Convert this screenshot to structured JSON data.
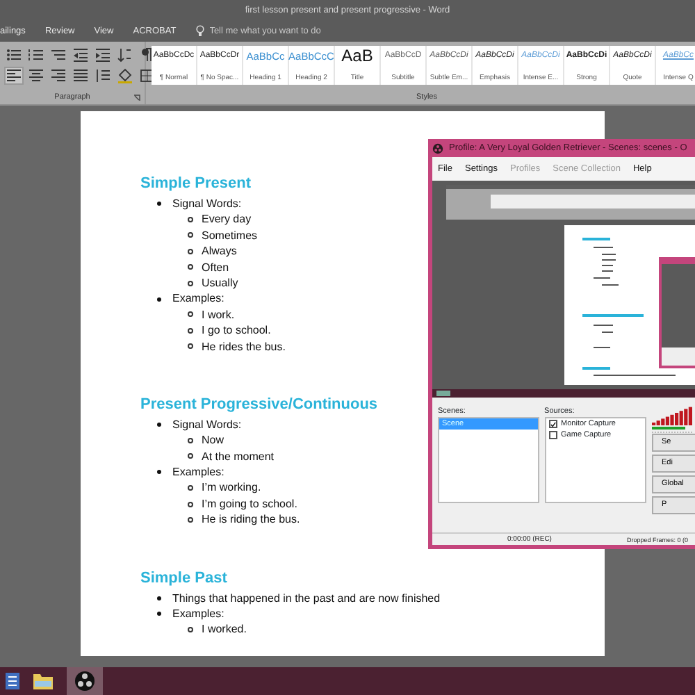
{
  "window": {
    "title": "first lesson present and present progressive - Word"
  },
  "ribbon_tabs": [
    {
      "label": "ailings"
    },
    {
      "label": "Review"
    },
    {
      "label": "View"
    },
    {
      "label": "ACROBAT"
    }
  ],
  "tell_me": {
    "placeholder": "Tell me what you want to do"
  },
  "paragraph_group": {
    "label": "Paragraph",
    "tools": [
      {
        "kind": "bullets"
      },
      {
        "kind": "numbering"
      },
      {
        "kind": "multilevel"
      },
      {
        "kind": "outdent"
      },
      {
        "kind": "indent"
      },
      {
        "kind": "sort"
      },
      {
        "kind": "pilcrow"
      },
      {
        "kind": "align-left",
        "selected": true
      },
      {
        "kind": "align-center",
        "selected": false
      },
      {
        "kind": "align-right",
        "selected": false
      },
      {
        "kind": "justify",
        "selected": false
      },
      {
        "kind": "spacing"
      },
      {
        "kind": "shading"
      },
      {
        "kind": "borders"
      }
    ]
  },
  "styles_group": {
    "label": "Styles",
    "styles": [
      {
        "preview": "AaBbCcDc",
        "name": "¶ Normal",
        "kind": "normal"
      },
      {
        "preview": "AaBbCcDr",
        "name": "¶ No Spac...",
        "kind": "normal"
      },
      {
        "preview": "AaBbCc",
        "name": "Heading 1",
        "kind": "heading"
      },
      {
        "preview": "AaBbCcC",
        "name": "Heading 2",
        "kind": "heading"
      },
      {
        "preview": "AaB",
        "name": "Title",
        "kind": "title"
      },
      {
        "preview": "AaBbCcD",
        "name": "Subtitle",
        "kind": "subtle"
      },
      {
        "preview": "AaBbCcDi",
        "name": "Subtle Em...",
        "kind": "subtle-italic"
      },
      {
        "preview": "AaBbCcDi",
        "name": "Emphasis",
        "kind": "italic"
      },
      {
        "preview": "AaBbCcDi",
        "name": "Intense E...",
        "kind": "accent-italic"
      },
      {
        "preview": "AaBbCcDi",
        "name": "Strong",
        "kind": "bold"
      },
      {
        "preview": "AaBbCcDi",
        "name": "Quote",
        "kind": "italic"
      },
      {
        "preview": "AaBbCc",
        "name": "Intense Q",
        "kind": "accent-underline"
      }
    ]
  },
  "document": {
    "sections": [
      {
        "heading": "Simple Present",
        "items": [
          {
            "text": "Signal Words:",
            "children": [
              {
                "text": "Every day"
              },
              {
                "text": "Sometimes"
              },
              {
                "text": "Always"
              },
              {
                "text": "Often"
              },
              {
                "text": "Usually"
              }
            ]
          },
          {
            "text": "Examples:",
            "children": [
              {
                "text": "I work."
              },
              {
                "text": "I go to school."
              },
              {
                "text": "He rides the bus."
              }
            ]
          }
        ]
      },
      {
        "heading": "Present Progressive/Continuous",
        "items": [
          {
            "text": "Signal Words:",
            "children": [
              {
                "text": "Now"
              },
              {
                "text": "At the moment"
              }
            ]
          },
          {
            "text": "Examples:",
            "children": [
              {
                "text": "I’m working."
              },
              {
                "text": "I’m going to school."
              },
              {
                "text": "He is riding the bus."
              }
            ]
          }
        ]
      },
      {
        "heading": "Simple Past",
        "items": [
          {
            "text": "Things that happened in the past and are now finished"
          },
          {
            "text": "Examples:",
            "children": [
              {
                "text": "I worked."
              }
            ]
          }
        ]
      }
    ]
  },
  "obs": {
    "title": "Profile: A Very Loyal Golden Retriever - Scenes: scenes - O",
    "menu": [
      {
        "label": "File",
        "disabled": false
      },
      {
        "label": "Settings",
        "disabled": false
      },
      {
        "label": "Profiles",
        "disabled": true
      },
      {
        "label": "Scene Collection",
        "disabled": true
      },
      {
        "label": "Help",
        "disabled": false
      }
    ],
    "scenes": {
      "label": "Scenes:",
      "items": [
        {
          "label": "Scene",
          "selected": true
        }
      ]
    },
    "sources": {
      "label": "Sources:",
      "items": [
        {
          "label": "Monitor Capture",
          "checked": true
        },
        {
          "label": "Game Capture",
          "checked": false
        }
      ]
    },
    "buttons": [
      "Se",
      "Edi",
      "Global",
      "P"
    ],
    "status": {
      "time": "0:00:00 (REC)",
      "dropped": "Dropped Frames: 0 (0"
    }
  },
  "taskbar": {
    "apps": [
      {
        "kind": "word",
        "selected": false
      },
      {
        "kind": "folder",
        "selected": false
      },
      {
        "kind": "obs",
        "selected": true
      }
    ]
  }
}
